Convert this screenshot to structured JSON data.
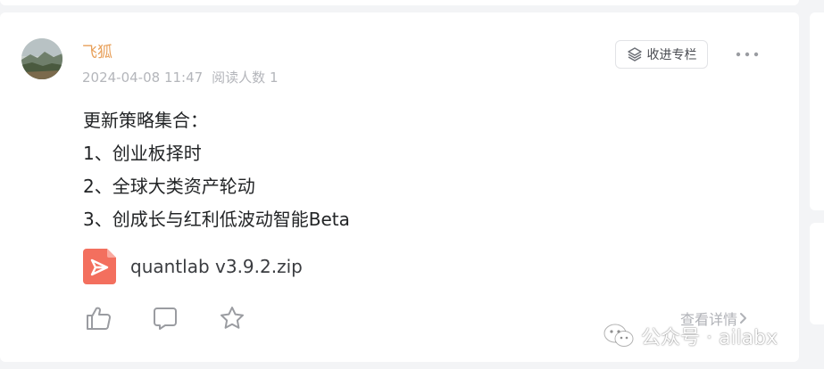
{
  "post": {
    "author": "飞狐",
    "date": "2024-04-08 11:47",
    "read_count": "阅读人数 1",
    "collect_label": "收进专栏",
    "content_lines": [
      "更新策略集合：",
      "1、创业板择时",
      "2、全球大类资产轮动",
      "3、创成长与红利低波动智能Beta"
    ],
    "attachment": {
      "file_name": "quantlab v3.9.2.zip",
      "icon": "pdf-file-icon",
      "icon_color": "#f36f5e"
    },
    "actions": [
      {
        "name": "like-button",
        "icon": "thumbs-up-icon"
      },
      {
        "name": "comment-button",
        "icon": "comment-icon"
      },
      {
        "name": "star-button",
        "icon": "star-icon"
      }
    ],
    "detail_label": "查看详情"
  },
  "watermark": {
    "text": "公众号 · ailabx",
    "icon": "wechat-icon"
  },
  "colors": {
    "author": "#e8a05a",
    "meta": "#b4b6bb",
    "text": "#222426",
    "background": "#f3f4f6"
  }
}
